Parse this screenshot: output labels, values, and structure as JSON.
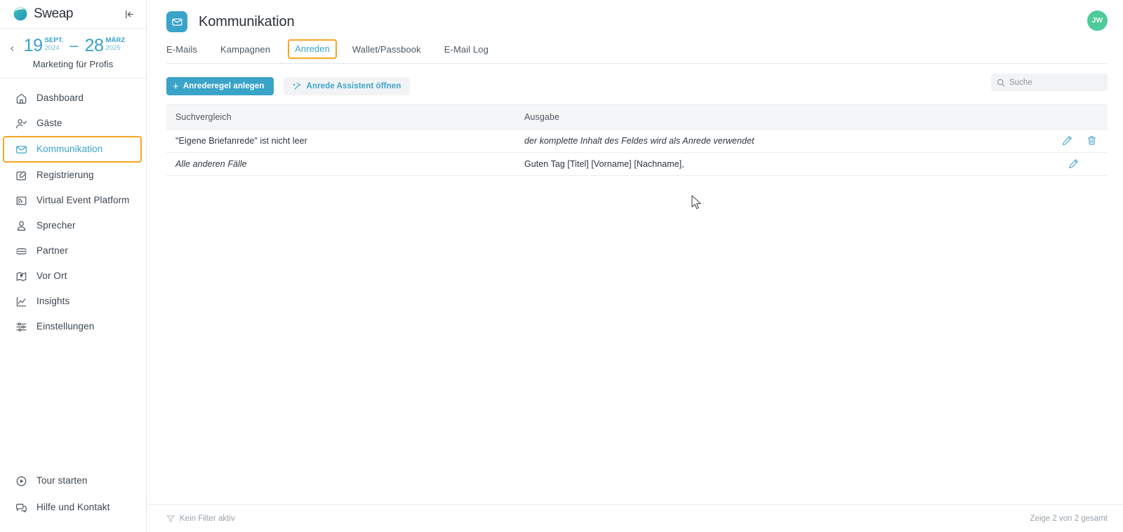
{
  "sidebar": {
    "brand": "Sweap",
    "brand_icon": "sweap-logo-icon",
    "collapse_icon": "collapse-sidebar-icon",
    "event": {
      "back_icon": "chevron-left-icon",
      "start_day": "19",
      "start_month": "SEPT.",
      "start_year": "2024",
      "dash": "–",
      "end_day": "28",
      "end_month": "MÄRZ",
      "end_year": "2025",
      "name": "Marketing für Profis"
    },
    "items": [
      {
        "label": "Dashboard",
        "icon": "home-icon",
        "active": false
      },
      {
        "label": "Gäste",
        "icon": "user-check-icon",
        "active": false
      },
      {
        "label": "Kommunikation",
        "icon": "envelope-icon",
        "active": true,
        "highlighted": true
      },
      {
        "label": "Registrierung",
        "icon": "form-edit-icon",
        "active": false
      },
      {
        "label": "Virtual Event Platform",
        "icon": "screen-cast-icon",
        "active": false
      },
      {
        "label": "Sprecher",
        "icon": "speaker-person-icon",
        "active": false
      },
      {
        "label": "Partner",
        "icon": "handshake-icon",
        "active": false
      },
      {
        "label": "Vor Ort",
        "icon": "map-pin-icon",
        "active": false
      },
      {
        "label": "Insights",
        "icon": "chart-line-icon",
        "active": false
      },
      {
        "label": "Einstellungen",
        "icon": "sliders-icon",
        "active": false
      }
    ],
    "bottom_items": [
      {
        "label": "Tour starten",
        "icon": "play-circle-icon"
      },
      {
        "label": "Hilfe und Kontakt",
        "icon": "chat-bubbles-icon"
      }
    ]
  },
  "header": {
    "title": "Kommunikation",
    "title_icon": "envelope-icon",
    "avatar_initials": "JW"
  },
  "tabs": [
    {
      "label": "E-Mails",
      "active": false,
      "highlighted": false
    },
    {
      "label": "Kampagnen",
      "active": false,
      "highlighted": false
    },
    {
      "label": "Anreden",
      "active": true,
      "highlighted": true
    },
    {
      "label": "Wallet/Passbook",
      "active": false,
      "highlighted": false
    },
    {
      "label": "E-Mail Log",
      "active": false,
      "highlighted": false
    }
  ],
  "toolbar": {
    "create_rule_label": "Anrederegel anlegen",
    "create_rule_icon": "plus-icon",
    "assistant_label": "Anrede Assistent öffnen",
    "assistant_icon": "magic-wand-icon",
    "search_placeholder": "Suche",
    "search_value": "",
    "search_icon": "search-icon"
  },
  "table": {
    "columns": [
      "Suchvergleich",
      "Ausgabe"
    ],
    "rows": [
      {
        "match": "\"Eigene Briefanrede\" ist nicht leer",
        "match_italic": false,
        "output": "der komplette Inhalt des Feldes wird als Anrede verwendet",
        "output_italic": true,
        "edit_icon": "pencil-icon",
        "delete_icon": "trash-icon",
        "has_delete": true
      },
      {
        "match": "Alle anderen Fälle",
        "match_italic": true,
        "output": "Guten Tag [Titel] [Vorname] [Nachname],",
        "output_italic": false,
        "edit_icon": "pencil-icon",
        "delete_icon": "trash-icon",
        "has_delete": false
      }
    ]
  },
  "footer": {
    "filter_label": "Kein Filter aktiv",
    "filter_icon": "funnel-icon",
    "count_label": "Zeige 2 von 2 gesamt"
  },
  "colors": {
    "accent": "#3aa3c9",
    "highlight": "#f5a623",
    "avatar": "#4ecb9a",
    "table_header_bg": "#f5f6f7",
    "soft_button_bg": "#f1f3f4"
  }
}
